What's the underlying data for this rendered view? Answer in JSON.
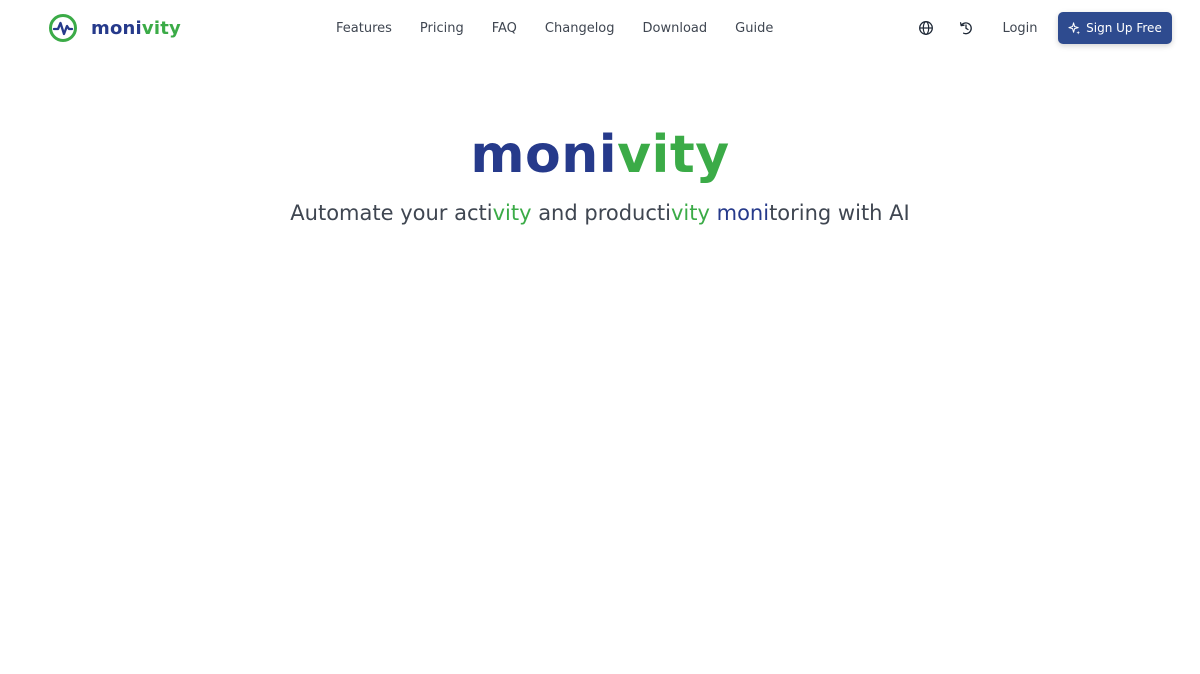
{
  "brand": {
    "name_part1": "moni",
    "name_part2": "vity",
    "colors": {
      "blue": "#263a8b",
      "green": "#3bab47",
      "button": "#2e4b8f"
    },
    "logo_icon": "pulse-circle-icon"
  },
  "nav": {
    "links": [
      "Features",
      "Pricing",
      "FAQ",
      "Changelog",
      "Download",
      "Guide"
    ]
  },
  "header_actions": {
    "language_icon": "globe-icon",
    "history_icon": "history-icon",
    "login_label": "Login",
    "signup_label": "Sign Up Free",
    "signup_icon": "sparkle-icon"
  },
  "hero": {
    "title_part1": "moni",
    "title_part2": "vity",
    "subtitle": {
      "s1": "Automate your acti",
      "s2": "vity",
      "s3": " and producti",
      "s4": "vity",
      "s5": " ",
      "s6": "moni",
      "s7": "toring with AI"
    }
  }
}
